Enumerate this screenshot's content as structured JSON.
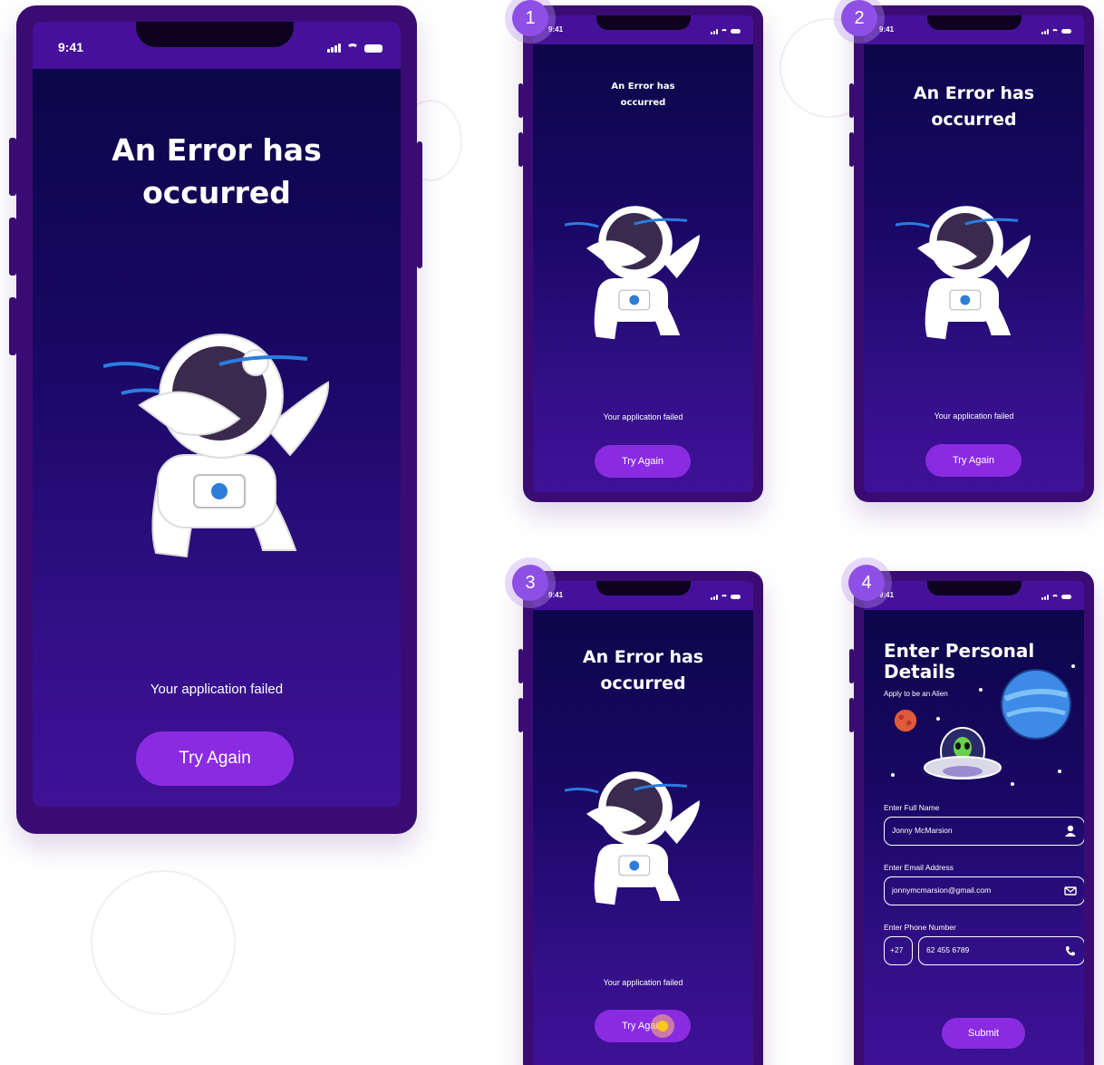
{
  "status": {
    "time": "9:41"
  },
  "error_screen": {
    "title_line1": "An Error has",
    "title_line2": "occurred",
    "failed_text": "Your application failed",
    "button_label": "Try Again"
  },
  "steps": [
    "1",
    "2",
    "3",
    "4"
  ],
  "form_screen": {
    "title_line1": "Enter Personal",
    "title_line2": "Details",
    "subtitle": "Apply to be an Alien",
    "name_label": "Enter Full Name",
    "name_value": "Jonny McMarsion",
    "email_label": "Enter Email Address",
    "email_value": "jonnymcmarsion@gmail.com",
    "phone_label": "Enter Phone Number",
    "phone_code": "+27",
    "phone_value": "62 455 6789",
    "submit_label": "Submit"
  },
  "colors": {
    "primary": "#8a2be2",
    "frame": "#3a0c73",
    "screen_top": "#0a0545",
    "screen_bottom": "#3f1196"
  }
}
